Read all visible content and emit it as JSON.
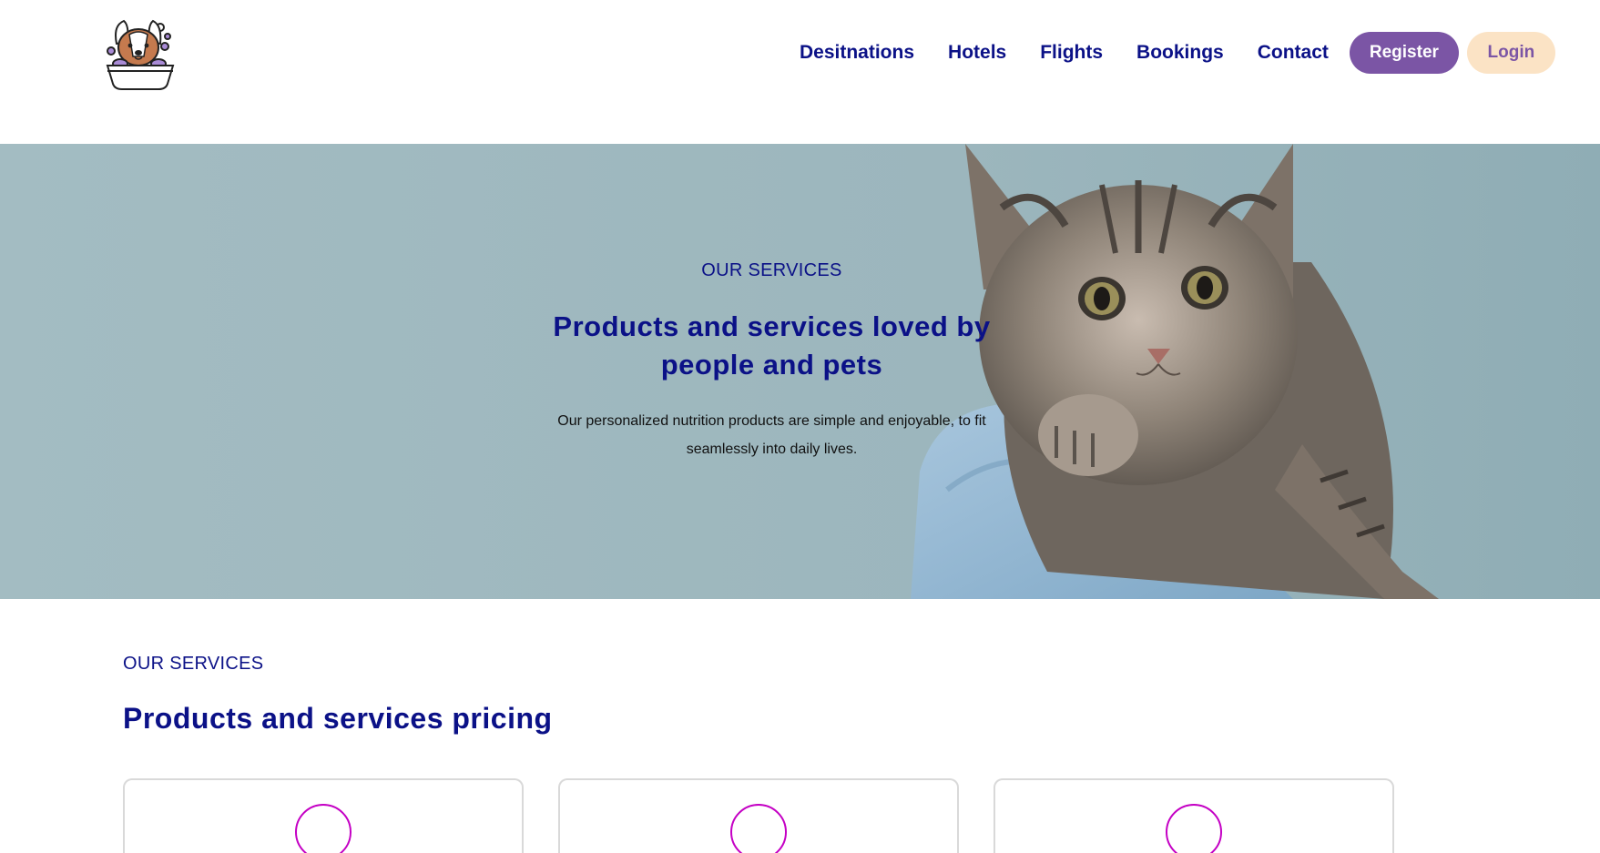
{
  "header": {
    "logo_icon": "dog-in-bathtub-logo-icon",
    "nav": [
      {
        "label": "Desitnations"
      },
      {
        "label": "Hotels"
      },
      {
        "label": "Flights"
      },
      {
        "label": "Bookings"
      },
      {
        "label": "Contact"
      }
    ],
    "register_label": "Register",
    "login_label": "Login"
  },
  "hero": {
    "eyebrow": "OUR SERVICES",
    "title": "Products and services loved by people and pets",
    "description": "Our personalized nutrition products are simple and enjoyable, to fit seamlessly into daily lives.",
    "image": "kitten-held-in-gloved-hand"
  },
  "services": {
    "eyebrow": "OUR SERVICES",
    "title": "Products and services pricing",
    "cards": [
      {
        "icon": "service-circle-icon"
      },
      {
        "icon": "service-circle-icon"
      },
      {
        "icon": "service-circle-icon"
      }
    ]
  },
  "colors": {
    "navy": "#0b1187",
    "purple": "#7b55a5",
    "peach": "#fbe3c5",
    "hero_bg": "#9fb9bf",
    "card_icon": "#c400c4"
  }
}
